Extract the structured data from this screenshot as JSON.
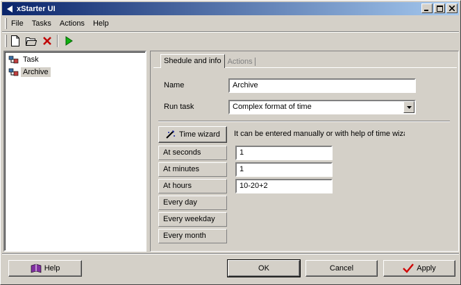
{
  "window": {
    "title": "xStarter UI"
  },
  "menu": {
    "items": [
      "File",
      "Tasks",
      "Actions",
      "Help"
    ]
  },
  "tree": {
    "items": [
      {
        "label": "Task",
        "selected": false
      },
      {
        "label": "Archive",
        "selected": true
      }
    ]
  },
  "tabs": {
    "active": "Shedule and info",
    "inactive": "Actions"
  },
  "form": {
    "name_label": "Name",
    "name_value": "Archive",
    "run_label": "Run task",
    "run_value": "Complex format of time",
    "wizard_button": "Time wizard",
    "wizard_hint": "It can be entered manually or with help of time wizard",
    "fields": [
      {
        "label": "At seconds",
        "value": "1"
      },
      {
        "label": "At minutes",
        "value": "1"
      },
      {
        "label": "At hours",
        "value": "10-20+2"
      },
      {
        "label": "Every day",
        "value": null
      },
      {
        "label": "Every weekday",
        "value": null
      },
      {
        "label": "Every month",
        "value": null
      }
    ]
  },
  "buttons": {
    "help": "Help",
    "ok": "OK",
    "cancel": "Cancel",
    "apply": "Apply"
  }
}
